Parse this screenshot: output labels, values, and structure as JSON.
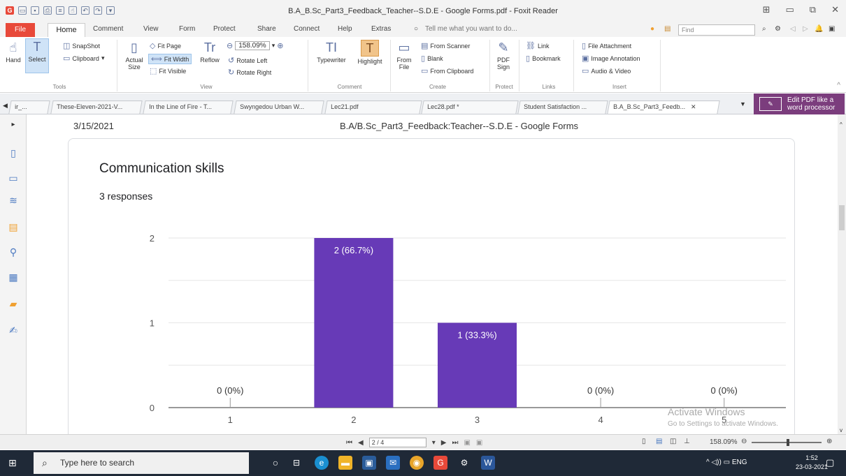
{
  "window": {
    "title": "B.A_B.Sc_Part3_Feedback_Teacher--S.D.E - Google Forms.pdf - Foxit Reader"
  },
  "menu": {
    "tabs": [
      "File",
      "Home",
      "Comment",
      "View",
      "Form",
      "Protect",
      "Share",
      "Connect",
      "Help",
      "Extras"
    ],
    "tell_me": "Tell me what you want to do...",
    "find_placeholder": "Find"
  },
  "ribbon": {
    "tools": {
      "hand": "Hand",
      "select": "Select",
      "snapshot": "SnapShot",
      "clipboard": "Clipboard",
      "group": "Tools"
    },
    "view": {
      "actual_size_1": "Actual",
      "actual_size_2": "Size",
      "fit_page": "Fit Page",
      "fit_width": "Fit Width",
      "fit_visible": "Fit Visible",
      "reflow": "Reflow",
      "zoom_value": "158.09%",
      "rotate_left": "Rotate Left",
      "rotate_right": "Rotate Right",
      "group": "View"
    },
    "comment": {
      "typewriter": "Typewriter",
      "highlight": "Highlight",
      "group": "Comment"
    },
    "create": {
      "from_file_1": "From",
      "from_file_2": "File",
      "from_scanner": "From Scanner",
      "blank": "Blank",
      "from_clipboard": "From Clipboard",
      "group": "Create"
    },
    "protect": {
      "pdf_sign_1": "PDF",
      "pdf_sign_2": "Sign",
      "group": "Protect"
    },
    "links": {
      "link": "Link",
      "bookmark": "Bookmark",
      "group": "Links"
    },
    "insert": {
      "file_attachment": "File Attachment",
      "image_annotation": "Image Annotation",
      "audio_video": "Audio & Video",
      "group": "Insert"
    }
  },
  "doc_tabs": [
    "ir_...",
    "These-Eleven-2021-V...",
    "In the Line of Fire - T...",
    "Swyngedou Urban W...",
    "Lec21.pdf",
    "Lec28.pdf *",
    "Student Satisfaction ...",
    "B.A_B.Sc_Part3_Feedb..."
  ],
  "edit_pdf": {
    "line1": "Edit PDF like a",
    "line2": "word processor"
  },
  "page": {
    "date": "3/15/2021",
    "doc_title": "B.A/B.Sc_Part3_Feedback:Teacher--S.D.E - Google Forms",
    "question": "Communication skills",
    "responses": "3 responses"
  },
  "chart_data": {
    "type": "bar",
    "categories": [
      "1",
      "2",
      "3",
      "4",
      "5"
    ],
    "values": [
      0,
      2,
      1,
      0,
      0
    ],
    "data_labels": [
      "0 (0%)",
      "2 (66.7%)",
      "1 (33.3%)",
      "0 (0%)",
      "0 (0%)"
    ],
    "y_ticks": [
      "0",
      "1",
      "2"
    ],
    "ylim": [
      0,
      2
    ],
    "bar_color": "#673ab7",
    "grid": true,
    "title": "",
    "xlabel": "",
    "ylabel": ""
  },
  "watermark": {
    "line1": "Activate Windows",
    "line2": "Go to Settings to activate Windows."
  },
  "status": {
    "page_field": "2 / 4",
    "zoom": "158.09%"
  },
  "taskbar": {
    "search_placeholder": "Type here to search",
    "lang": "ENG",
    "time": "1:52",
    "date": "23-03-2021"
  }
}
